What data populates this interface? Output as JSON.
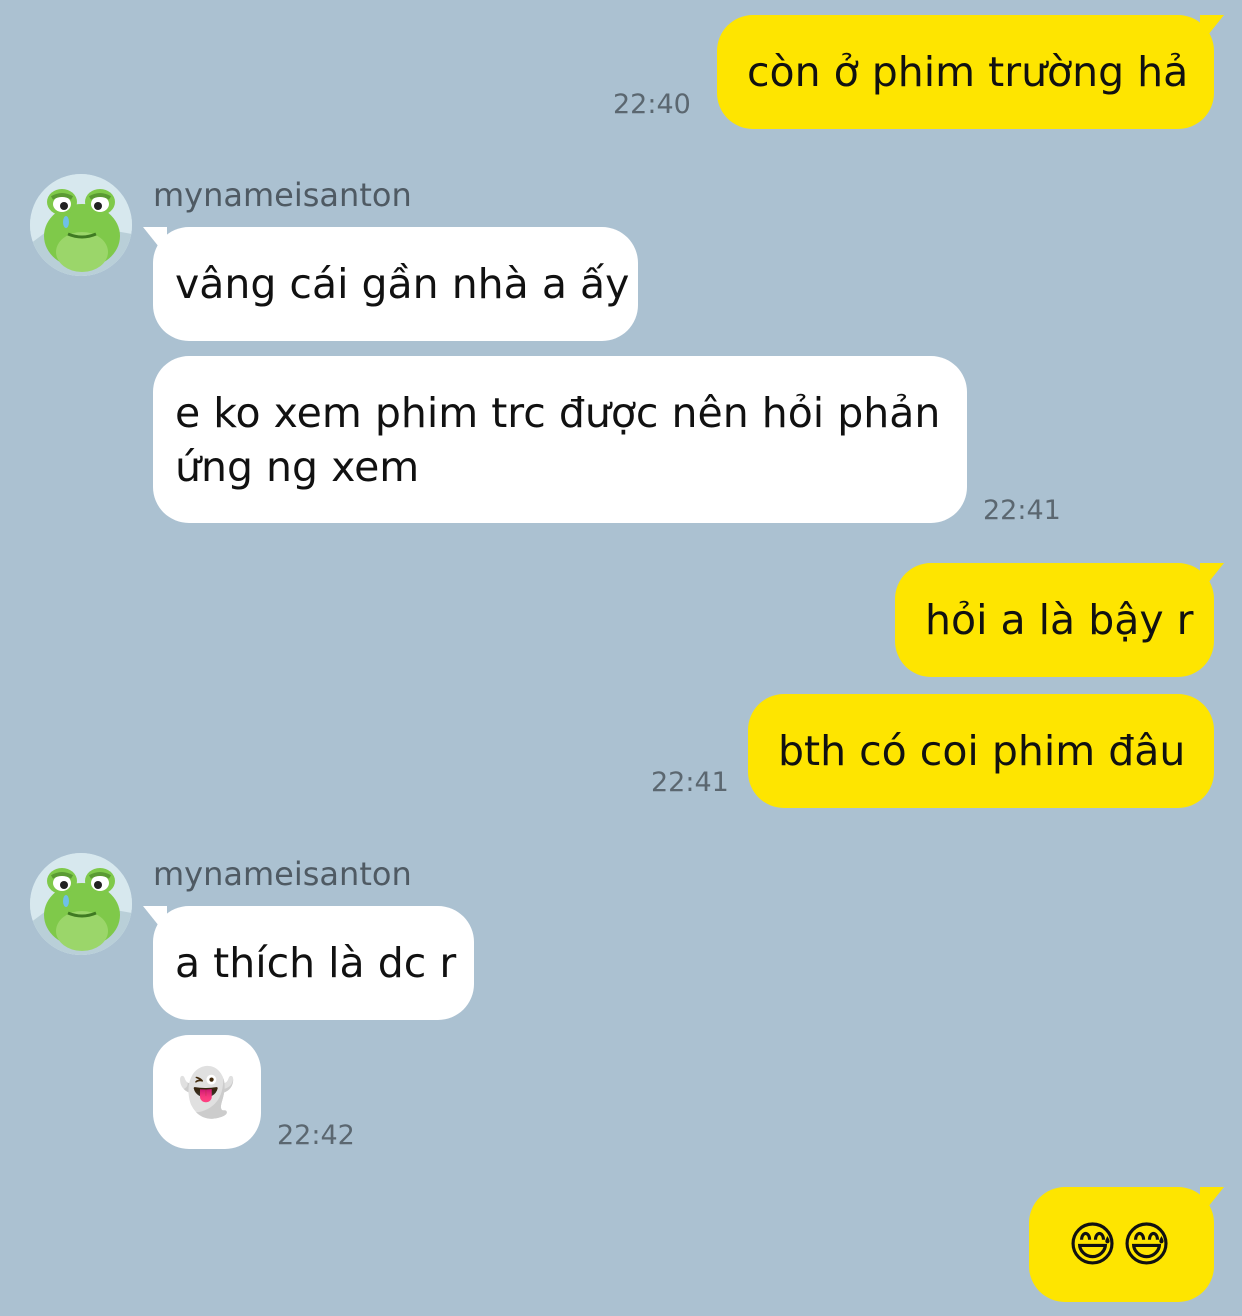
{
  "colors": {
    "background": "#abc1d1",
    "my_bubble": "#fee500",
    "other_bubble": "#ffffff"
  },
  "messages": [
    {
      "id": "m1",
      "side": "me",
      "text": "còn ở phim trường hả",
      "time": "22:40"
    },
    {
      "id": "m2",
      "side": "other",
      "sender": "mynameisanton",
      "avatar_icon": "frog-avatar-icon",
      "text": "vâng cái gần nhà a ấy"
    },
    {
      "id": "m3",
      "side": "other",
      "text_line1": "e ko xem phim trc được nên hỏi phản",
      "text_line2": "ứng ng xem",
      "time": "22:41"
    },
    {
      "id": "m4",
      "side": "me",
      "text": "hỏi a là bậy r"
    },
    {
      "id": "m5",
      "side": "me",
      "text": "bth có coi phim đâu",
      "time": "22:41"
    },
    {
      "id": "m6",
      "side": "other",
      "sender": "mynameisanton",
      "avatar_icon": "frog-avatar-icon",
      "text": "a thích là dc r"
    },
    {
      "id": "m7",
      "side": "other",
      "text": "👻",
      "time": "22:42"
    },
    {
      "id": "m8",
      "side": "me",
      "text": "😅😅"
    }
  ]
}
